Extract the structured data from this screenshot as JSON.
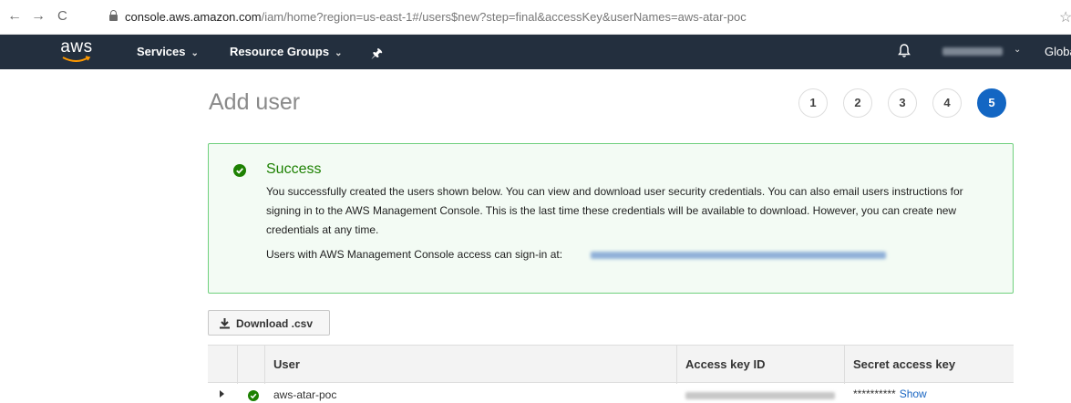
{
  "browser": {
    "back": "←",
    "forward": "→",
    "reload": "C",
    "url_host": "console.aws.amazon.com",
    "url_path": "/iam/home?region=us-east-1#/users$new?step=final&accessKey&userNames=aws-atar-poc",
    "bookmark_star": "☆"
  },
  "navbar": {
    "logo_text": "aws",
    "services_label": "Services",
    "resource_groups_label": "Resource Groups",
    "pin": "🖈",
    "caret": "⌄",
    "region_label": "Globa",
    "colors": {
      "background": "#232f3e",
      "logo_smile": "#ff9900"
    }
  },
  "page": {
    "title": "Add user",
    "steps": [
      "1",
      "2",
      "3",
      "4",
      "5"
    ],
    "active_step": "5",
    "colors": {
      "step_active": "#1366c3"
    }
  },
  "success": {
    "title": "Success",
    "message": "You successfully created the users shown below. You can view and download user security credentials. You can also email users instructions for signing in to the AWS Management Console. This is the last time these credentials will be available to download. However, you can create new credentials at any time.",
    "signin_text": "Users with AWS Management Console access can sign-in at:",
    "colors": {
      "border": "#6fd07d",
      "background": "#f3fbf4",
      "title": "#1d8102"
    }
  },
  "download": {
    "label": "Download .csv",
    "icon": "download-icon"
  },
  "table": {
    "columns": [
      "User",
      "Access key ID",
      "Secret access key"
    ],
    "rows": [
      {
        "user": "aws-atar-poc",
        "secret_masked": "**********",
        "secret_action": "Show"
      }
    ]
  }
}
